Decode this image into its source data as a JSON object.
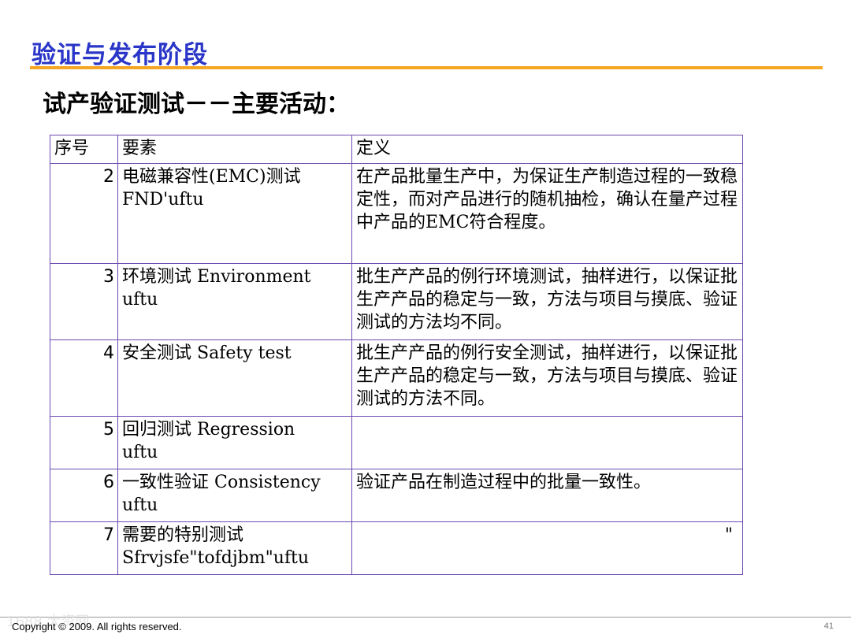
{
  "slide": {
    "title": "验证与发布阶段",
    "subtitle": "试产验证测试－－主要活动："
  },
  "table": {
    "headers": [
      "序号",
      "要素",
      "定义"
    ],
    "rows": [
      {
        "num": "2",
        "element_lines": [
          "电磁兼容性(EMC)测试",
          "FND'uftu"
        ],
        "definition": "在产品批量生产中，为保证生产制造过程的一致稳定性，而对产品进行的随机抽检，确认在量产过程中产品的EMC符合程度。"
      },
      {
        "num": "3",
        "element_lines": [
          "环境测试 Environment",
          "uftu"
        ],
        "definition": "批生产产品的例行环境测试，抽样进行，以保证批生产产品的稳定与一致，方法与项目与摸底、验证测试的方法均不同。"
      },
      {
        "num": "4",
        "element_lines": [
          "安全测试 Safety test"
        ],
        "definition": "批生产产品的例行安全测试，抽样进行，以保证批生产产品的稳定与一致，方法与项目与摸底、验证测试的方法不同。"
      },
      {
        "num": "5",
        "element_lines": [
          "回归测试 Regression",
          "uftu"
        ],
        "definition": ""
      },
      {
        "num": "6",
        "element_lines": [
          "一致性验证 Consistency",
          "uftu"
        ],
        "definition": "验证产品在制造过程中的批量一致性。"
      },
      {
        "num": "7",
        "element_lines": [
          "需要的特别测试",
          "Sfrvjsfe\"tofdjbm\"uftu"
        ],
        "definition": "\""
      }
    ]
  },
  "footer": {
    "copyright": "Copyright © 2009. All rights reserved.",
    "watermark": "1688 大资网",
    "page_number": "41"
  }
}
